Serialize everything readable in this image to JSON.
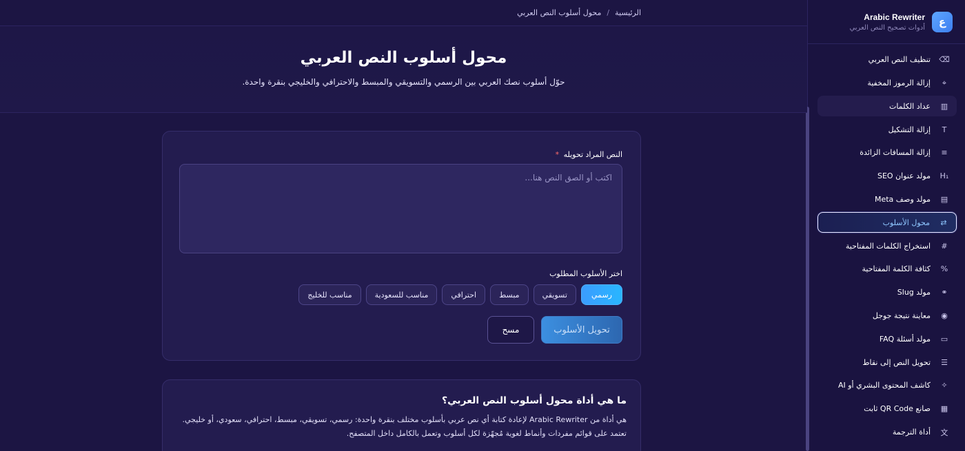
{
  "brand": {
    "name": "Arabic Rewriter",
    "subtitle": "أدوات تصحيح النص العربي",
    "logo_glyph": "ع",
    "accent": "#4a96ff"
  },
  "sidebar": {
    "items": [
      {
        "label": "تنظيف النص العربي",
        "icon": "eraser-icon",
        "glyph": "⌫"
      },
      {
        "label": "إزالة الرموز المخفية",
        "icon": "scan-icon",
        "glyph": "⌖"
      },
      {
        "label": "عداد الكلمات",
        "icon": "bar-chart-icon",
        "glyph": "▥"
      },
      {
        "label": "إزالة التشكيل",
        "icon": "type-icon",
        "glyph": "T"
      },
      {
        "label": "إزالة المسافات الزائدة",
        "icon": "lines-icon",
        "glyph": "≡"
      },
      {
        "label": "مولد عنوان SEO",
        "icon": "heading-icon",
        "glyph": "H₁"
      },
      {
        "label": "مولد وصف Meta",
        "icon": "file-icon",
        "glyph": "▤"
      },
      {
        "label": "محول الأسلوب",
        "icon": "repeat-icon",
        "glyph": "⇄"
      },
      {
        "label": "استخراج الكلمات المفتاحية",
        "icon": "hash-icon",
        "glyph": "#"
      },
      {
        "label": "كثافة الكلمة المفتاحية",
        "icon": "percent-icon",
        "glyph": "%"
      },
      {
        "label": "مولد Slug",
        "icon": "link-icon",
        "glyph": "⚭"
      },
      {
        "label": "معاينة نتيجة جوجل",
        "icon": "eye-icon",
        "glyph": "◉"
      },
      {
        "label": "مولد أسئلة FAQ",
        "icon": "message-icon",
        "glyph": "▭"
      },
      {
        "label": "تحويل النص إلى نقاط",
        "icon": "list-icon",
        "glyph": "☰"
      },
      {
        "label": "كاشف المحتوى البشري أو AI",
        "icon": "sparkle-scan-icon",
        "glyph": "✧"
      },
      {
        "label": "صانع QR Code ثابت",
        "icon": "qr-icon",
        "glyph": "▦"
      },
      {
        "label": "أداة الترجمة",
        "icon": "translate-icon",
        "glyph": "文"
      }
    ],
    "active_index": 7,
    "hover_index": 2
  },
  "breadcrumb": {
    "home": "الرئيسية",
    "separator": "/",
    "current": "محول أسلوب النص العربي"
  },
  "hero": {
    "title": "محول أسلوب النص العربي",
    "subtitle": "حوّل أسلوب نصك العربي بين الرسمي والتسويقي والمبسط والاحترافي والخليجي بنقرة واحدة."
  },
  "form": {
    "text_label": "النص المراد تحويله",
    "required_mark": "*",
    "placeholder": "اكتب أو الصق النص هنا...",
    "value": "",
    "style_label": "اختر الأسلوب المطلوب",
    "styles": [
      "رسمي",
      "تسويقي",
      "مبسط",
      "احترافي",
      "مناسب للسعودية",
      "مناسب للخليج"
    ],
    "selected_style": "رسمي",
    "convert_button": "تحويل الأسلوب",
    "clear_button": "مسح"
  },
  "info": {
    "title": "ما هي أداة محول أسلوب النص العربي؟",
    "body": "هي أداة من Arabic Rewriter لإعادة كتابة أي نص عربي بأسلوب مختلف بنقرة واحدة: رسمي، تسويقي، مبسط، احترافي، سعودي، أو خليجي. تعتمد على قوائم مفردات وأنماط لغوية مُجهّزة لكل أسلوب وتعمل بالكامل داخل المتصفح."
  }
}
